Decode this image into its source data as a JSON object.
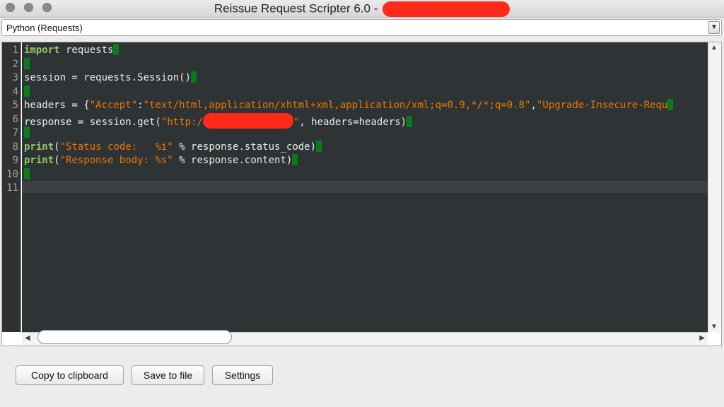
{
  "window": {
    "title": "Reissue Request Scripter 6.0 -"
  },
  "language_select": {
    "value": "Python (Requests)"
  },
  "editor": {
    "line_numbers": [
      "1",
      "2",
      "3",
      "4",
      "5",
      "6",
      "7",
      "8",
      "9",
      "10",
      "11"
    ],
    "lines": [
      {
        "segments": [
          {
            "t": "import",
            "c": "kw"
          },
          {
            "t": " requests"
          }
        ]
      },
      {
        "segments": []
      },
      {
        "segments": [
          {
            "t": "session = requests.Session()"
          }
        ]
      },
      {
        "segments": []
      },
      {
        "segments": [
          {
            "t": "headers = {"
          },
          {
            "t": "\"Accept\"",
            "c": "str"
          },
          {
            "t": ":"
          },
          {
            "t": "\"text/html,application/xhtml+xml,application/xml;q=0.9,*/*;q=0.8\"",
            "c": "str"
          },
          {
            "t": ","
          },
          {
            "t": "\"Upgrade-Insecure-Requ",
            "c": "str"
          }
        ]
      },
      {
        "segments": [
          {
            "t": "response = session.get("
          },
          {
            "t": "\"http:/",
            "c": "str"
          },
          {
            "redact": true
          },
          {
            "t": "\"",
            "c": "str"
          },
          {
            "t": ", headers=headers)"
          }
        ]
      },
      {
        "segments": []
      },
      {
        "segments": [
          {
            "t": "print",
            "c": "kw"
          },
          {
            "t": "("
          },
          {
            "t": "\"Status code:   %i\"",
            "c": "str"
          },
          {
            "t": " % response.status_code)"
          }
        ]
      },
      {
        "segments": [
          {
            "t": "print",
            "c": "kw"
          },
          {
            "t": "("
          },
          {
            "t": "\"Response body: %s\"",
            "c": "str"
          },
          {
            "t": " % response.content)"
          }
        ]
      },
      {
        "segments": []
      },
      {
        "segments": [],
        "no_caret": true
      }
    ]
  },
  "buttons": {
    "copy": "Copy to clipboard",
    "save": "Save to file",
    "settings": "Settings"
  },
  "colors": {
    "editor_background": "#2e3436",
    "keyword": "#93c763",
    "string": "#ec7600",
    "caret": "#0a7a1a",
    "redaction": "#ff2a1a"
  }
}
